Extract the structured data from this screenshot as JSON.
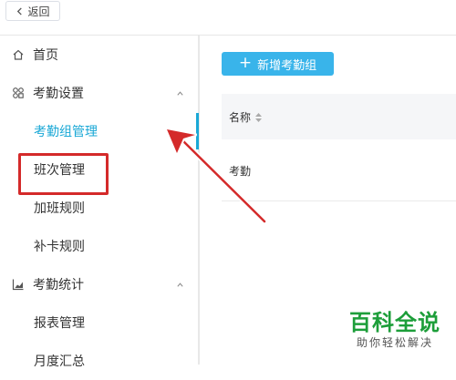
{
  "topbar": {
    "back_label": "返回"
  },
  "sidebar": {
    "home": "首页",
    "attendance_settings": {
      "label": "考勤设置",
      "items": [
        "考勤组管理",
        "班次管理",
        "加班规则",
        "补卡规则"
      ]
    },
    "attendance_stats": {
      "label": "考勤统计",
      "items": [
        "报表管理",
        "月度汇总"
      ]
    }
  },
  "main": {
    "add_button": "新增考勤组",
    "table": {
      "columns": [
        "名称"
      ],
      "rows": [
        [
          "考勤"
        ]
      ]
    }
  },
  "watermark": {
    "title": "百科全说",
    "subtitle": "助你轻松解决"
  },
  "colors": {
    "accent": "#1aa8d6",
    "button": "#39b4ea",
    "highlight": "#d42a2a",
    "watermark": "#1d9e3a"
  }
}
